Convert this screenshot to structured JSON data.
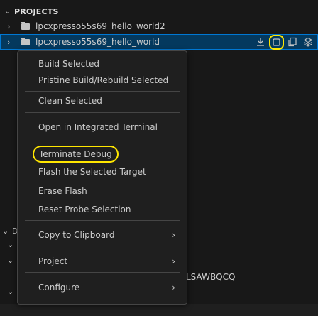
{
  "projects_header": {
    "chevron": "chevron-down-icon",
    "title": "PROJECTS"
  },
  "tree": [
    {
      "label": "lpcxpresso55s69_hello_world2",
      "chevron": "chevron-right-icon",
      "icon": "folder-icon"
    },
    {
      "label": "lpcxpresso55s69_hello_world",
      "chevron": "chevron-right-icon",
      "icon": "folder-icon",
      "selected": true
    }
  ],
  "row_actions": [
    {
      "name": "build-icon",
      "glyph": "⍗"
    },
    {
      "name": "stop-debug-icon",
      "glyph": "▢",
      "highlighted": true
    },
    {
      "name": "copy-icon",
      "glyph": "⎘"
    },
    {
      "name": "layers-icon",
      "glyph": "◈"
    }
  ],
  "background": {
    "gutter_letter": "D",
    "partial_text": "LSAWBQCQ"
  },
  "context_menu": {
    "build_selected": "Build Selected",
    "pristine_build": "Pristine Build/Rebuild Selected",
    "clean_selected": "Clean Selected",
    "open_terminal": "Open in Integrated Terminal",
    "terminate_debug": "Terminate Debug",
    "flash_target": "Flash the Selected Target",
    "erase_flash": "Erase Flash",
    "reset_probe": "Reset Probe Selection",
    "copy_clipboard": "Copy to Clipboard",
    "project": "Project",
    "configure": "Configure",
    "submenu_glyph": "›"
  },
  "colors": {
    "highlight_ring": "#ffe600",
    "selection_bg": "#04395e",
    "selection_border": "#0078d4",
    "menu_bg": "#1f1f1f"
  }
}
